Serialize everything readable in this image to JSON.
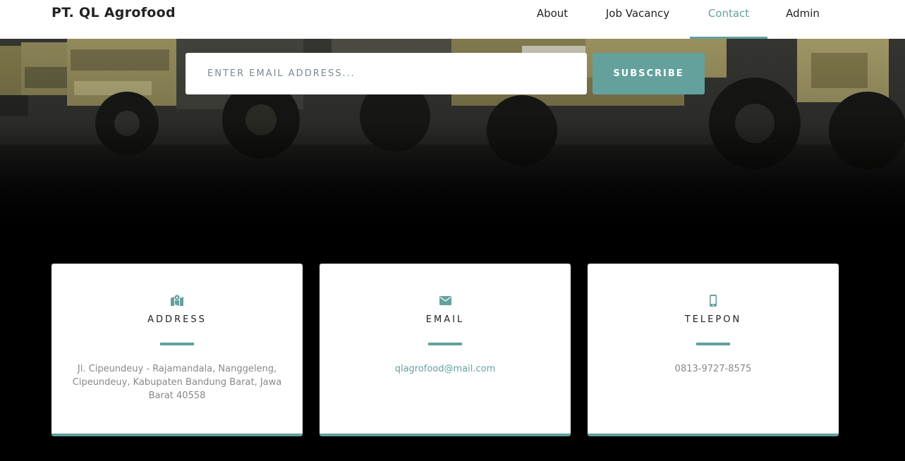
{
  "navbar": {
    "brand": "PT. QL Agrofood",
    "items": [
      {
        "label": "About",
        "active": false
      },
      {
        "label": "Job Vacancy",
        "active": false
      },
      {
        "label": "Contact",
        "active": true
      },
      {
        "label": "Admin",
        "active": false
      }
    ]
  },
  "subscribe": {
    "placeholder": "ENTER EMAIL ADDRESS...",
    "value": "",
    "button_label": "SUBSCRIBE"
  },
  "contact_cards": [
    {
      "icon": "map-marked-icon",
      "title": "ADDRESS",
      "text": "Jl. Cipeundeuy - Rajamandala, Nanggeleng, Cipeundeuy, Kabupaten Bandung Barat, Jawa Barat 40558"
    },
    {
      "icon": "envelope-icon",
      "title": "EMAIL",
      "text": "qlagrofood@mail.com"
    },
    {
      "icon": "mobile-phone-icon",
      "title": "TELEPON",
      "text": "0813-9727-8575"
    }
  ],
  "colors": {
    "accent": "#64a19d",
    "background": "#000000",
    "card": "#ffffff"
  }
}
